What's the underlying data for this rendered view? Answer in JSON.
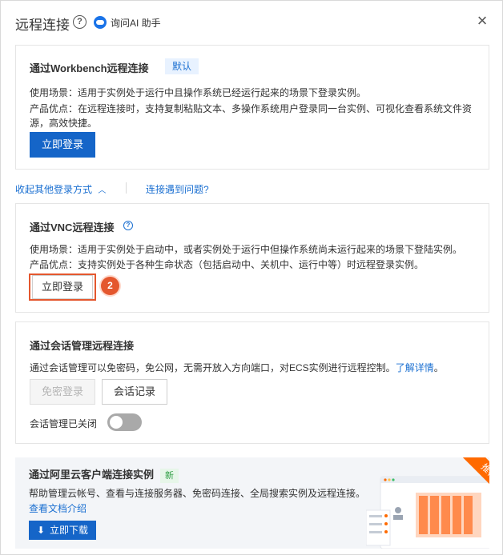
{
  "header": {
    "title": "远程连接",
    "help": "?",
    "ai_label": "询问AI 助手",
    "close": "×"
  },
  "workbench": {
    "title": "通过Workbench远程连接",
    "tag": "默认",
    "scenario": "使用场景：适用于实例处于运行中且操作系统已经运行起来的场景下登录实例。",
    "advantage_line1": "产品优点：在远程连接时，支持复制粘贴文本、多操作系统用户登录同一台实例、可视化查看系统文件资",
    "advantage_line2": "源，高效快捷。",
    "login_button": "立即登录"
  },
  "toggles": {
    "collapse_link": "收起其他登录方式",
    "problem_link": "连接遇到问题?"
  },
  "vnc": {
    "title": "通过VNC远程连接",
    "scenario": "使用场景：适用于实例处于启动中，或者实例处于运行中但操作系统尚未运行起来的场景下登陆实例。",
    "advantage": "产品优点：支持实例处于各种生命状态（包括启动中、关机中、运行中等）时远程登录实例。",
    "login_button": "立即登录",
    "step_badge": "2"
  },
  "session": {
    "title": "通过会话管理远程连接",
    "desc": "通过会话管理可以免密码，免公网，无需开放入方向端口，对ECS实例进行远程控制。",
    "learn_more": "了解详情",
    "desc_end": "。",
    "passwordless_button": "免密登录",
    "records_button": "会话记录",
    "status_label": "会话管理已关闭",
    "toggle_on": false
  },
  "client": {
    "title": "通过阿里云客户端连接实例",
    "new_tag": "新",
    "desc": "帮助管理云帐号、查看与连接服务器、免密码连接、全局搜索实例及远程连接。",
    "docs_link": "查看文档介绍",
    "download_button": "立即下载",
    "ribbon": "推荐"
  },
  "colors": {
    "primary": "#1565c8",
    "link": "#1a6fd1",
    "highlight": "#e4572e",
    "ribbon": "#ff6a00"
  }
}
